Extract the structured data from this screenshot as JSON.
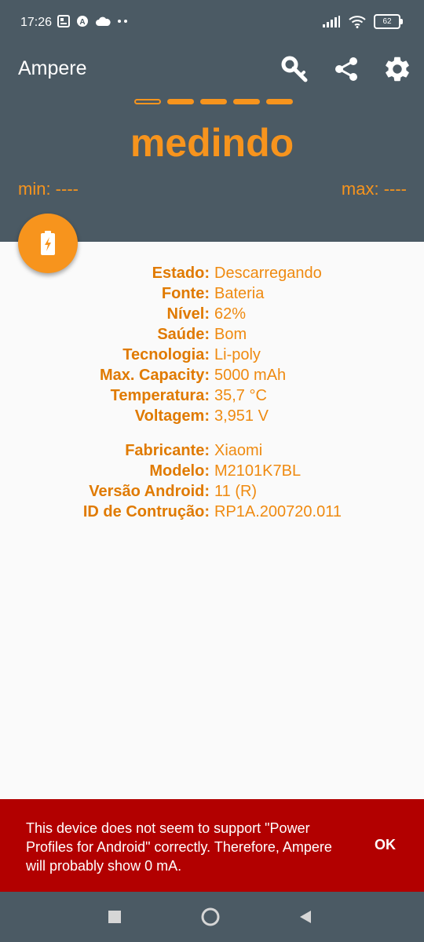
{
  "status_bar": {
    "time": "17:26",
    "battery_level": "62"
  },
  "app": {
    "title": "Ampere",
    "status_word": "medindo",
    "min_label": "min: ----",
    "max_label": "max: ----",
    "accent_color": "#f7941d",
    "toolbar_color": "#4b5a64"
  },
  "info": {
    "battery": [
      {
        "key": "Estado:",
        "value": "Descarregando"
      },
      {
        "key": "Fonte:",
        "value": "Bateria"
      },
      {
        "key": "Nível:",
        "value": "62%"
      },
      {
        "key": "Saúde:",
        "value": "Bom"
      },
      {
        "key": "Tecnologia:",
        "value": "Li-poly"
      },
      {
        "key": "Max. Capacity:",
        "value": "5000 mAh"
      },
      {
        "key": "Temperatura:",
        "value": "35,7 °C"
      },
      {
        "key": "Voltagem:",
        "value": "3,951 V"
      }
    ],
    "device": [
      {
        "key": "Fabricante:",
        "value": "Xiaomi"
      },
      {
        "key": "Modelo:",
        "value": "M2101K7BL"
      },
      {
        "key": "Versão Android:",
        "value": "11 (R)"
      },
      {
        "key": "ID de Contrução:",
        "value": "RP1A.200720.011"
      }
    ]
  },
  "snackbar": {
    "message": "This device does not seem to support \"Power Profiles for Android\" correctly. Therefore, Ampere will probably show 0 mA.",
    "action": "OK",
    "color": "#b20000"
  }
}
